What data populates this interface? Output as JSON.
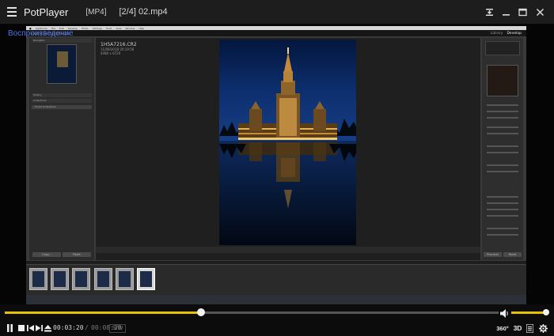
{
  "titlebar": {
    "app_name": "PotPlayer",
    "format": "[MP4]",
    "filename": "[2/4] 02.mp4"
  },
  "video": {
    "osd_text": "Воспроизведение",
    "lightroom": {
      "modules_inactive": "Library",
      "modules_active": "Develop",
      "photo_name": "1H5A7216.CR2",
      "photo_date": "11/09/2018 20:19:56",
      "photo_size": "4480 x 6720",
      "copy_label": "Copy...",
      "paste_label": "Paste",
      "prev_label": "Previous",
      "reset_label": "Reset"
    }
  },
  "playback": {
    "progress": 0.398,
    "volume": 0.96,
    "current_time": "00:03:20",
    "separator": "/",
    "total_time": "00:08:28",
    "sw_label": "S/W",
    "btn_360": "360°",
    "btn_3d": "3D"
  },
  "colors": {
    "accent": "#e7c200",
    "osd": "#4f73e8"
  }
}
